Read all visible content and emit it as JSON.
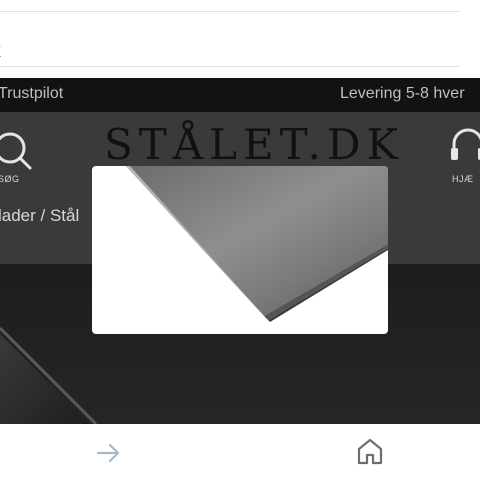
{
  "browser": {
    "url_fragment": "k"
  },
  "topbar": {
    "left_text": "Trustpilot",
    "right_text": "Levering 5-8 hver"
  },
  "header": {
    "search_label": "SØG",
    "logo_text": "STÅLET.DK",
    "help_label": "HJÆ"
  },
  "breadcrumb": {
    "text": "lader / Stål"
  },
  "modal": {
    "image": "steel-plate-photo"
  },
  "bottom_nav": {
    "forward_icon": "arrow-right-icon",
    "home_icon": "home-icon"
  },
  "colors": {
    "topbar": "#111214",
    "header": "#3a3a3a",
    "modal": "#ffffff"
  }
}
